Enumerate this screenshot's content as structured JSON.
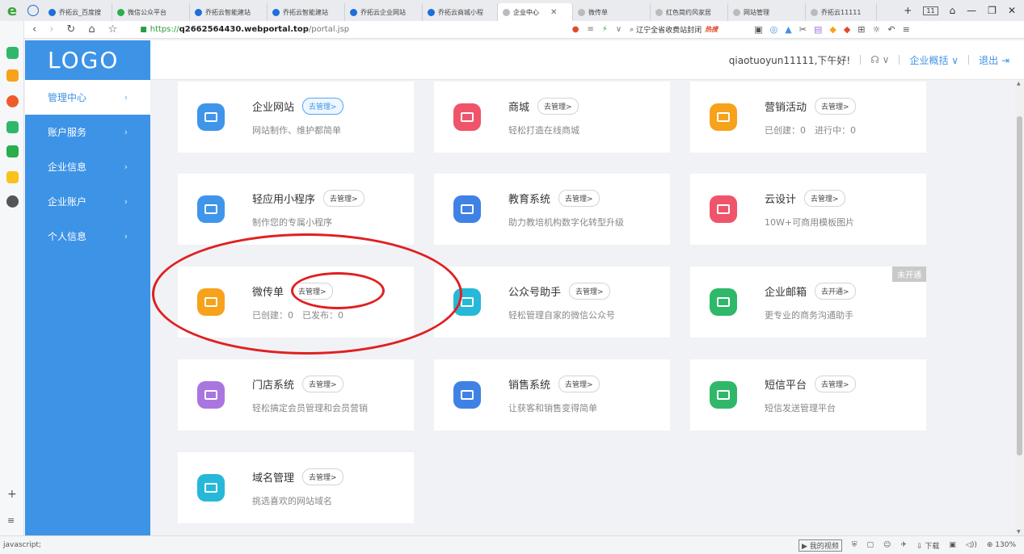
{
  "browser": {
    "tabs": [
      {
        "title": "乔拓云_百度搜",
        "icon_color": "#1e6fd9"
      },
      {
        "title": "微信公众平台",
        "icon_color": "#2aae4a"
      },
      {
        "title": "乔拓云智能建站",
        "icon_color": "#1e6fd9"
      },
      {
        "title": "乔拓云智能建站",
        "icon_color": "#1e6fd9"
      },
      {
        "title": "乔拓云企业网站",
        "icon_color": "#1e6fd9"
      },
      {
        "title": "乔拓云商城小程",
        "icon_color": "#1e6fd9"
      },
      {
        "title": "企业中心",
        "icon_color": "#bbbbbb",
        "active": true
      },
      {
        "title": "微传单",
        "icon_color": "#bbbbbb"
      },
      {
        "title": "红色简约风家居",
        "icon_color": "#bbbbbb"
      },
      {
        "title": "网站管理",
        "icon_color": "#bbbbbb"
      },
      {
        "title": "乔拓云11111",
        "icon_color": "#bbbbbb"
      }
    ],
    "tab_count": "11",
    "url_scheme": "https://",
    "url_host": "q2662564430.webportal.top",
    "url_path": "/portal.jsp",
    "search_text": "辽宁全省收费站封闭",
    "search_hot": "热搜",
    "status_left": "javascript;",
    "status_video": "我的视频",
    "status_download": "下载",
    "zoom": "130%"
  },
  "header": {
    "logo": "LOGO",
    "greeting": "qiaotuoyun11111,下午好!",
    "overview": "企业概括",
    "logout": "退出"
  },
  "menu": [
    {
      "label": "管理中心",
      "active": true
    },
    {
      "label": "账户服务"
    },
    {
      "label": "企业信息"
    },
    {
      "label": "企业账户"
    },
    {
      "label": "个人信息"
    }
  ],
  "cards": [
    {
      "title": "企业网站",
      "btn": "去管理>",
      "desc": "网站制作、维护都简单",
      "color": "#3f95ea",
      "highlight": true
    },
    {
      "title": "商城",
      "btn": "去管理>",
      "desc": "轻松打造在线商城",
      "color": "#f0546a"
    },
    {
      "title": "营销活动",
      "btn": "去管理>",
      "desc": "已创建：0　进行中：0",
      "color": "#f7a21b"
    },
    {
      "title": "轻应用小程序",
      "btn": "去管理>",
      "desc": "制作您的专属小程序",
      "color": "#3f95ea"
    },
    {
      "title": "教育系统",
      "btn": "去管理>",
      "desc": "助力教培机构数字化转型升级",
      "color": "#3f82e6"
    },
    {
      "title": "云设计",
      "btn": "去管理>",
      "desc": "10W+可商用模板图片",
      "color": "#f0546a"
    },
    {
      "title": "微传单",
      "btn": "去管理>",
      "desc": "已创建：0　已发布：0",
      "color": "#f7a21b"
    },
    {
      "title": "公众号助手",
      "btn": "去管理>",
      "desc": "轻松管理自家的微信公众号",
      "color": "#26b8d8"
    },
    {
      "title": "企业邮箱",
      "btn": "去开通>",
      "desc": "更专业的商务沟通助手",
      "color": "#2fb86a",
      "badge": "未开通"
    },
    {
      "title": "门店系统",
      "btn": "去管理>",
      "desc": "轻松搞定会员管理和会员营销",
      "color": "#a976e0"
    },
    {
      "title": "销售系统",
      "btn": "去管理>",
      "desc": "让获客和销售变得简单",
      "color": "#3f82e6"
    },
    {
      "title": "短信平台",
      "btn": "去管理>",
      "desc": "短信发送管理平台",
      "color": "#2fb86a"
    },
    {
      "title": "域名管理",
      "btn": "去管理>",
      "desc": "挑选喜欢的网站域名",
      "color": "#26b8d8"
    }
  ]
}
